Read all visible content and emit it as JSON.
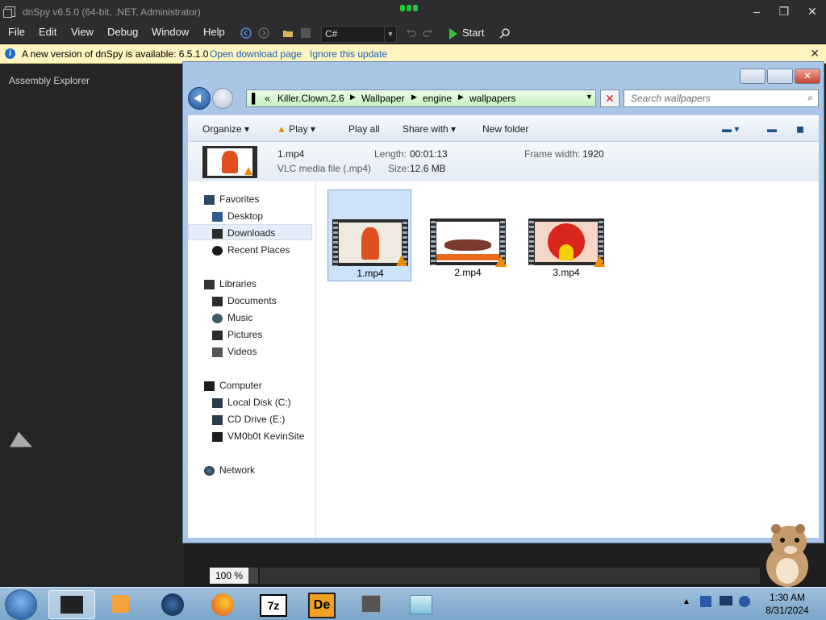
{
  "dnspy": {
    "title": "dnSpy v6.5.0 (64-bit, .NET, Administrator)",
    "menu": [
      "File",
      "Edit",
      "View",
      "Debug",
      "Window",
      "Help"
    ],
    "language": "C#",
    "start_label": "Start",
    "update_message": "A new version of dnSpy is available: 6.5.1.0",
    "open_download_page": "Open download page",
    "ignore_update": "Ignore this update",
    "assembly_explorer": "Assembly Explorer",
    "zoom": "100 %",
    "accent_color": "#22c33a"
  },
  "explorer": {
    "breadcrumb": [
      "Killer.Clown.2.6",
      "Wallpaper",
      "engine",
      "wallpapers"
    ],
    "search_placeholder": "Search wallpapers",
    "toolbar": {
      "organize": "Organize",
      "play": "Play",
      "play_all": "Play all",
      "share_with": "Share with",
      "new_folder": "New folder"
    },
    "details": {
      "name": "1.mp4",
      "type": "VLC media file (.mp4)",
      "length_label": "Length:",
      "length": "00:01:13",
      "size_label": "Size:",
      "size": "12.6 MB",
      "frame_width_label": "Frame width:",
      "frame_width": "1920"
    },
    "nav": {
      "favorites": "Favorites",
      "desktop": "Desktop",
      "downloads": "Downloads",
      "recent_places": "Recent Places",
      "libraries": "Libraries",
      "documents": "Documents",
      "music": "Music",
      "pictures": "Pictures",
      "videos": "Videos",
      "computer": "Computer",
      "local_disk": "Local Disk (C:)",
      "cd_drive": "CD Drive (E:)",
      "vm_share": "VM0b0t KevinSite",
      "network": "Network"
    },
    "files": [
      {
        "name": "1.mp4"
      },
      {
        "name": "2.mp4"
      },
      {
        "name": "3.mp4"
      }
    ]
  },
  "taskbar": {
    "time": "1:30 AM",
    "date": "8/31/2024"
  }
}
